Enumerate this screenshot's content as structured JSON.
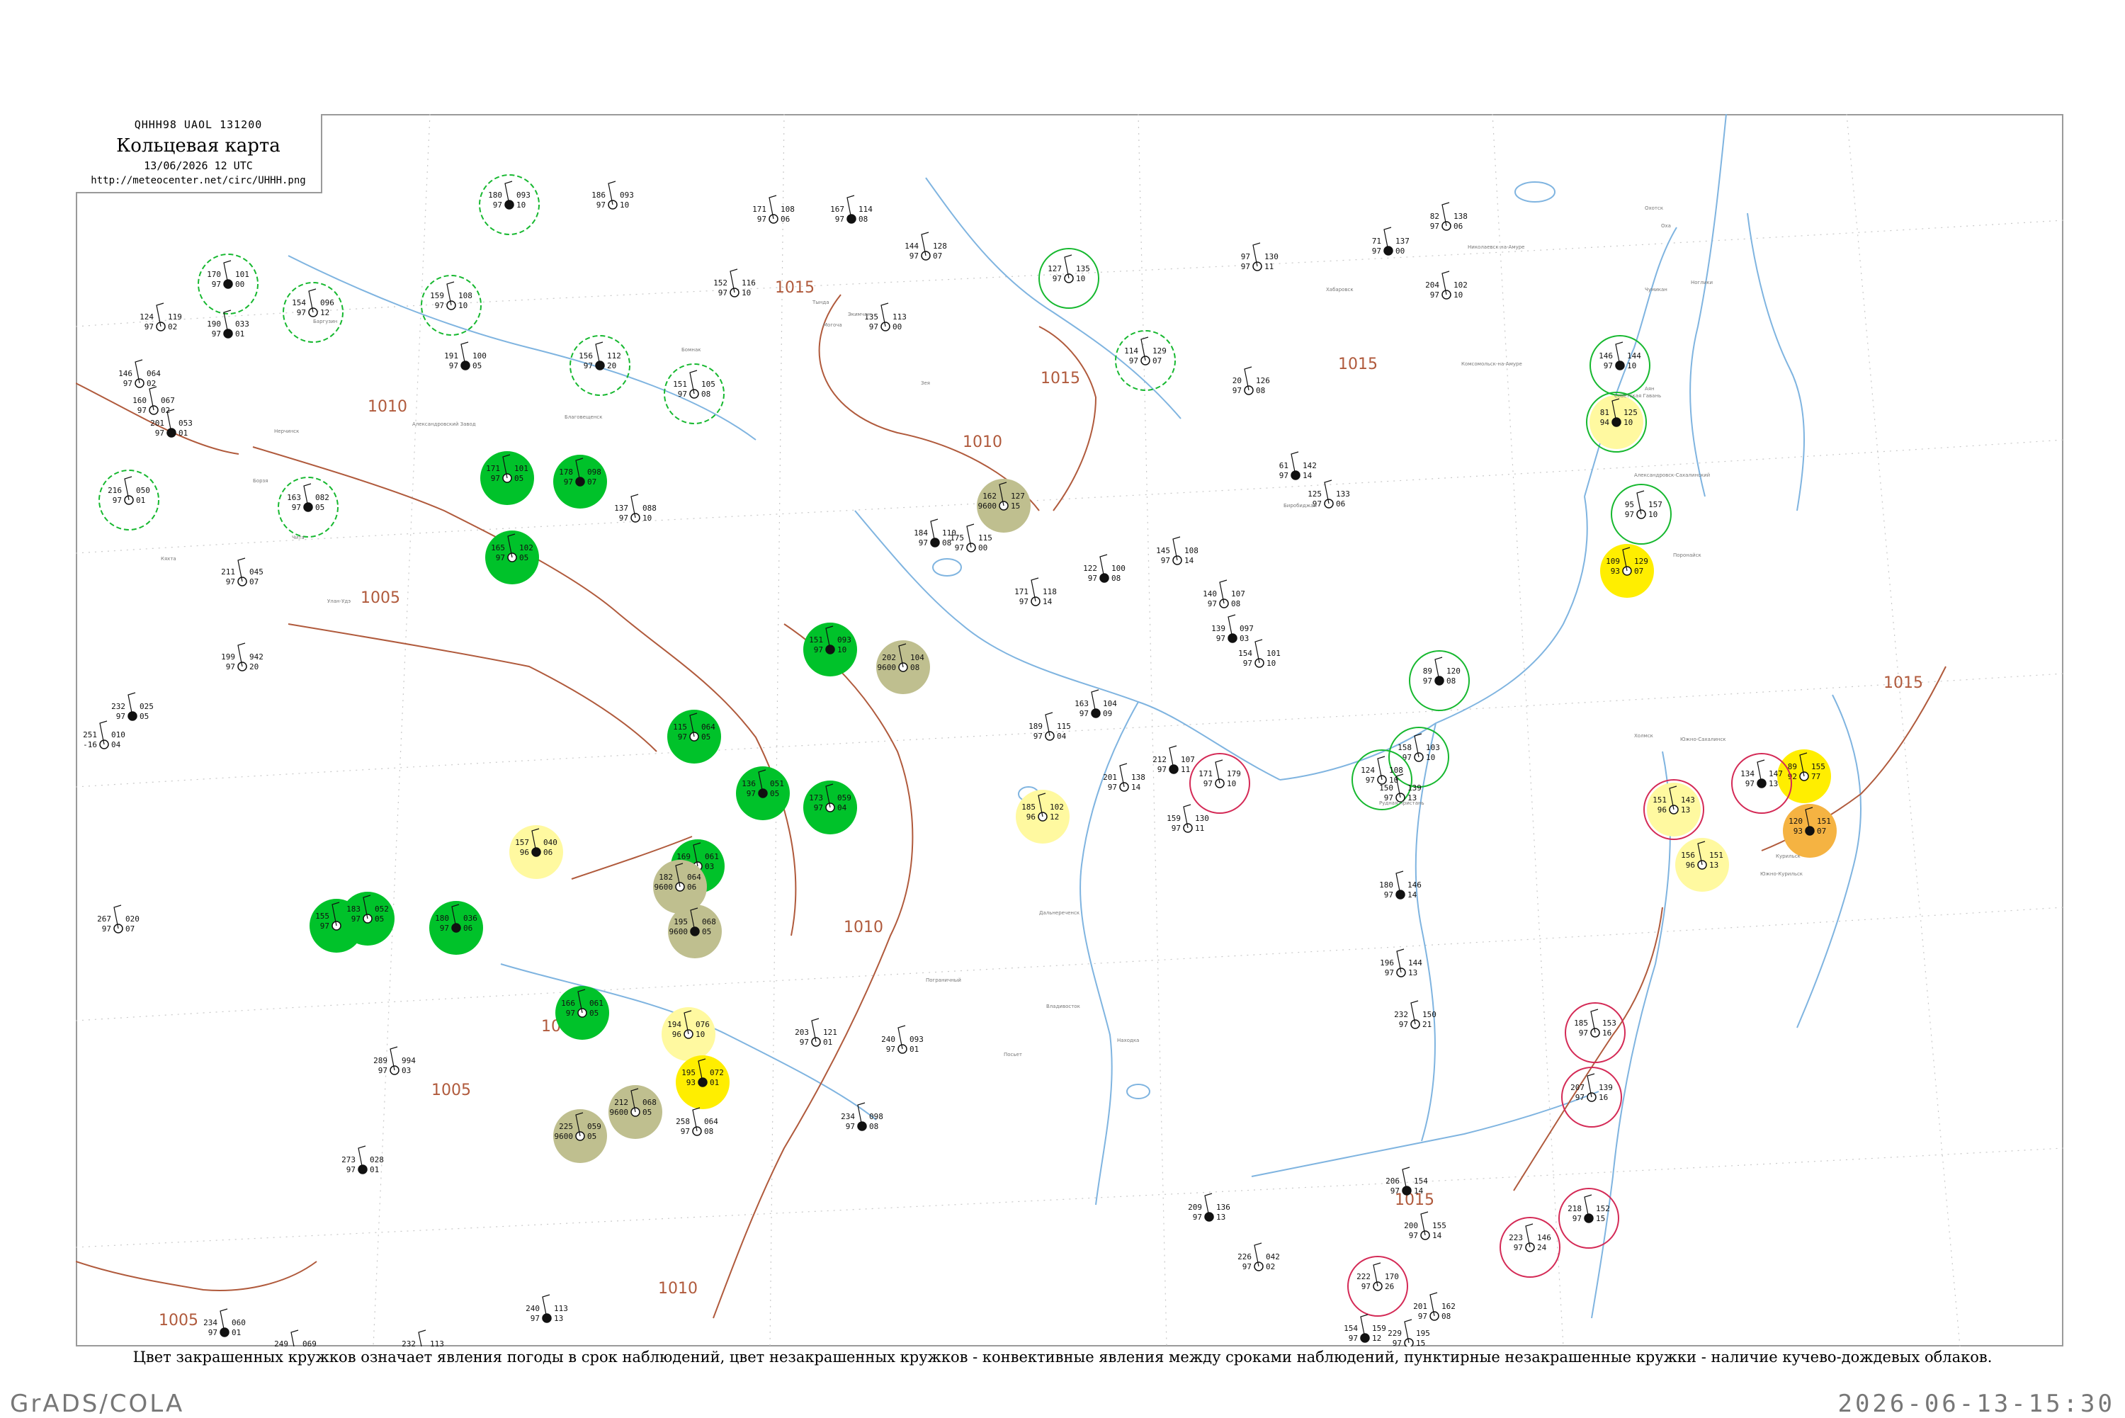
{
  "header": {
    "code": "QHHH98  UAOL  131200",
    "title": "Кольцевая карта",
    "date": "13/06/2026 12 UTC",
    "url": "http://meteocenter.net/circ/UHHH.png"
  },
  "caption": "Цвет закрашенных кружков означает явления погоды в срок наблюдений, цвет незакрашенных кружков - конвективные явления между сроками наблюдений, пунктирные незакрашенные кружки - наличие кучево-дождевых облаков.",
  "footer": {
    "left": "GrADS/COLA",
    "right": "2026-06-13-15:30"
  },
  "colors": {
    "isobar": "#b05a3c",
    "water": "#7fb4e0",
    "rain_fill": "#00c22a",
    "fog_fill": "#bfbf8f",
    "haze_fill": "#fff9a0",
    "yellow_fill": "#ffee00",
    "orange_fill": "#f5b342",
    "ring_green": "#16b82f",
    "ring_red": "#d42a56",
    "frame": "#9a9a9a"
  },
  "isobars": [
    {
      "label": "1015"
    },
    {
      "label": "1015"
    },
    {
      "label": "1015"
    },
    {
      "label": "1015"
    },
    {
      "label": "1015"
    },
    {
      "label": "1010"
    },
    {
      "label": "1010"
    },
    {
      "label": "1010"
    },
    {
      "label": "1010"
    },
    {
      "label": "1005"
    },
    {
      "label": "1005"
    },
    {
      "label": "1005"
    },
    {
      "label": "1005"
    }
  ],
  "stations": [
    {
      "t": "180",
      "d": "97",
      "p": "093",
      "v": "10",
      "fill": "",
      "ring": "green-dash"
    },
    {
      "t": "186",
      "d": "97",
      "p": "093",
      "v": "10",
      "fill": "",
      "ring": ""
    },
    {
      "t": "171",
      "d": "97",
      "p": "108",
      "v": "06",
      "fill": "",
      "ring": ""
    },
    {
      "t": "167",
      "d": "97",
      "p": "114",
      "v": "08",
      "fill": "",
      "ring": ""
    },
    {
      "t": "144",
      "d": "97",
      "p": "128",
      "v": "07",
      "fill": "",
      "ring": ""
    },
    {
      "t": "127",
      "d": "97",
      "p": "135",
      "v": "10",
      "fill": "",
      "ring": "green"
    },
    {
      "t": "170",
      "d": "97",
      "p": "101",
      "v": "00",
      "fill": "",
      "ring": "green-dash"
    },
    {
      "t": "154",
      "d": "97",
      "p": "096",
      "v": "12",
      "fill": "",
      "ring": "green-dash"
    },
    {
      "t": "159",
      "d": "97",
      "p": "108",
      "v": "10",
      "fill": "",
      "ring": "green-dash"
    },
    {
      "t": "156",
      "d": "97",
      "p": "112",
      "v": "20",
      "fill": "",
      "ring": "green-dash"
    },
    {
      "t": "151",
      "d": "97",
      "p": "105",
      "v": "08",
      "fill": "",
      "ring": "green-dash"
    },
    {
      "t": "114",
      "d": "97",
      "p": "129",
      "v": "07",
      "fill": "",
      "ring": "green-dash"
    },
    {
      "t": "163",
      "d": "97",
      "p": "082",
      "v": "05",
      "fill": "",
      "ring": "green-dash"
    },
    {
      "t": "216",
      "d": "97",
      "p": "050",
      "v": "01",
      "fill": "",
      "ring": "green-dash"
    },
    {
      "t": "171",
      "d": "97",
      "p": "101",
      "v": "05",
      "fill": "rain",
      "ring": ""
    },
    {
      "t": "178",
      "d": "97",
      "p": "098",
      "v": "07",
      "fill": "rain",
      "ring": ""
    },
    {
      "t": "165",
      "d": "97",
      "p": "102",
      "v": "05",
      "fill": "rain",
      "ring": ""
    },
    {
      "t": "162",
      "d": "9600",
      "p": "127",
      "v": "15",
      "fill": "fog",
      "ring": ""
    },
    {
      "t": "151",
      "d": "97",
      "p": "093",
      "v": "10",
      "fill": "rain",
      "ring": ""
    },
    {
      "t": "202",
      "d": "9600",
      "p": "104",
      "v": "08",
      "fill": "fog",
      "ring": ""
    },
    {
      "t": "115",
      "d": "97",
      "p": "064",
      "v": "05",
      "fill": "rain",
      "ring": ""
    },
    {
      "t": "136",
      "d": "97",
      "p": "051",
      "v": "05",
      "fill": "rain",
      "ring": ""
    },
    {
      "t": "173",
      "d": "97",
      "p": "059",
      "v": "04",
      "fill": "rain",
      "ring": ""
    },
    {
      "t": "185",
      "d": "96",
      "p": "102",
      "v": "12",
      "fill": "haze",
      "ring": ""
    },
    {
      "t": "157",
      "d": "96",
      "p": "040",
      "v": "06",
      "fill": "haze",
      "ring": ""
    },
    {
      "t": "169",
      "d": "97",
      "p": "061",
      "v": "03",
      "fill": "rain",
      "ring": ""
    },
    {
      "t": "182",
      "d": "9600",
      "p": "064",
      "v": "06",
      "fill": "fog",
      "ring": ""
    },
    {
      "t": "195",
      "d": "9600",
      "p": "068",
      "v": "05",
      "fill": "fog",
      "ring": ""
    },
    {
      "t": "155",
      "d": "97",
      "p": "067",
      "v": "05",
      "fill": "rain",
      "ring": ""
    },
    {
      "t": "183",
      "d": "97",
      "p": "052",
      "v": "05",
      "fill": "rain",
      "ring": ""
    },
    {
      "t": "180",
      "d": "97",
      "p": "036",
      "v": "06",
      "fill": "rain",
      "ring": ""
    },
    {
      "t": "194",
      "d": "96",
      "p": "076",
      "v": "10",
      "fill": "haze",
      "ring": ""
    },
    {
      "t": "166",
      "d": "97",
      "p": "061",
      "v": "05",
      "fill": "rain",
      "ring": ""
    },
    {
      "t": "195",
      "d": "93",
      "p": "072",
      "v": "01",
      "fill": "yellow",
      "ring": ""
    },
    {
      "t": "212",
      "d": "9600",
      "p": "068",
      "v": "05",
      "fill": "fog",
      "ring": ""
    },
    {
      "t": "225",
      "d": "9600",
      "p": "059",
      "v": "05",
      "fill": "fog",
      "ring": ""
    },
    {
      "t": "81",
      "d": "94",
      "p": "125",
      "v": "10",
      "fill": "haze",
      "ring": "green"
    },
    {
      "t": "109",
      "d": "93",
      "p": "129",
      "v": "07",
      "fill": "yellow",
      "ring": ""
    },
    {
      "t": "89",
      "d": "92",
      "p": "155",
      "v": "77",
      "fill": "yellow",
      "ring": ""
    },
    {
      "t": "120",
      "d": "93",
      "p": "151",
      "v": "07",
      "fill": "orange",
      "ring": ""
    },
    {
      "t": "151",
      "d": "96",
      "p": "143",
      "v": "13",
      "fill": "haze",
      "ring": "red"
    },
    {
      "t": "156",
      "d": "96",
      "p": "151",
      "v": "13",
      "fill": "haze",
      "ring": ""
    },
    {
      "t": "89",
      "d": "97",
      "p": "120",
      "v": "08",
      "fill": "",
      "ring": "green"
    },
    {
      "t": "158",
      "d": "97",
      "p": "103",
      "v": "10",
      "fill": "",
      "ring": "green"
    },
    {
      "t": "124",
      "d": "97",
      "p": "108",
      "v": "10",
      "fill": "",
      "ring": "green"
    },
    {
      "t": "146",
      "d": "97",
      "p": "144",
      "v": "10",
      "fill": "",
      "ring": "green"
    },
    {
      "t": "95",
      "d": "97",
      "p": "157",
      "v": "10",
      "fill": "",
      "ring": "green"
    },
    {
      "t": "171",
      "d": "97",
      "p": "179",
      "v": "10",
      "fill": "",
      "ring": "red"
    },
    {
      "t": "134",
      "d": "97",
      "p": "147",
      "v": "13",
      "fill": "",
      "ring": "red"
    },
    {
      "t": "185",
      "d": "97",
      "p": "153",
      "v": "16",
      "fill": "",
      "ring": "red"
    },
    {
      "t": "207",
      "d": "97",
      "p": "139",
      "v": "16",
      "fill": "",
      "ring": "red"
    },
    {
      "t": "218",
      "d": "97",
      "p": "152",
      "v": "15",
      "fill": "",
      "ring": "red"
    },
    {
      "t": "223",
      "d": "97",
      "p": "146",
      "v": "24",
      "fill": "",
      "ring": "red"
    },
    {
      "t": "222",
      "d": "97",
      "p": "170",
      "v": "26",
      "fill": "",
      "ring": "red"
    },
    {
      "t": "209",
      "d": "97",
      "p": "136",
      "v": "13",
      "fill": "",
      "ring": ""
    },
    {
      "t": "203",
      "d": "97",
      "p": "121",
      "v": "01",
      "fill": "",
      "ring": ""
    },
    {
      "t": "240",
      "d": "97",
      "p": "093",
      "v": "01",
      "fill": "",
      "ring": ""
    },
    {
      "t": "234",
      "d": "97",
      "p": "098",
      "v": "08",
      "fill": "",
      "ring": ""
    },
    {
      "t": "258",
      "d": "97",
      "p": "064",
      "v": "08",
      "fill": "",
      "ring": ""
    },
    {
      "t": "289",
      "d": "97",
      "p": "994",
      "v": "03",
      "fill": "",
      "ring": ""
    },
    {
      "t": "273",
      "d": "97",
      "p": "028",
      "v": "01",
      "fill": "",
      "ring": ""
    },
    {
      "t": "267",
      "d": "97",
      "p": "020",
      "v": "07",
      "fill": "",
      "ring": ""
    },
    {
      "t": "251",
      "d": "-16",
      "p": "010",
      "v": "04",
      "fill": "",
      "ring": ""
    },
    {
      "t": "232",
      "d": "97",
      "p": "025",
      "v": "05",
      "fill": "",
      "ring": ""
    },
    {
      "t": "199",
      "d": "97",
      "p": "942",
      "v": "20",
      "fill": "",
      "ring": ""
    },
    {
      "t": "211",
      "d": "97",
      "p": "045",
      "v": "07",
      "fill": "",
      "ring": ""
    },
    {
      "t": "190",
      "d": "97",
      "p": "033",
      "v": "01",
      "fill": "",
      "ring": ""
    },
    {
      "t": "146",
      "d": "97",
      "p": "064",
      "v": "02",
      "fill": "",
      "ring": ""
    },
    {
      "t": "160",
      "d": "97",
      "p": "067",
      "v": "02",
      "fill": "",
      "ring": ""
    },
    {
      "t": "201",
      "d": "97",
      "p": "053",
      "v": "01",
      "fill": "",
      "ring": ""
    },
    {
      "t": "137",
      "d": "97",
      "p": "088",
      "v": "10",
      "fill": "",
      "ring": ""
    },
    {
      "t": "124",
      "d": "97",
      "p": "119",
      "v": "02",
      "fill": "",
      "ring": ""
    },
    {
      "t": "191",
      "d": "97",
      "p": "100",
      "v": "05",
      "fill": "",
      "ring": ""
    },
    {
      "t": "152",
      "d": "97",
      "p": "116",
      "v": "10",
      "fill": "",
      "ring": ""
    },
    {
      "t": "135",
      "d": "97",
      "p": "113",
      "v": "00",
      "fill": "",
      "ring": ""
    },
    {
      "t": "184",
      "d": "97",
      "p": "110",
      "v": "08",
      "fill": "",
      "ring": ""
    },
    {
      "t": "175",
      "d": "97",
      "p": "115",
      "v": "00",
      "fill": "",
      "ring": ""
    },
    {
      "t": "171",
      "d": "97",
      "p": "118",
      "v": "14",
      "fill": "",
      "ring": ""
    },
    {
      "t": "122",
      "d": "97",
      "p": "100",
      "v": "08",
      "fill": "",
      "ring": ""
    },
    {
      "t": "145",
      "d": "97",
      "p": "108",
      "v": "14",
      "fill": "",
      "ring": ""
    },
    {
      "t": "140",
      "d": "97",
      "p": "107",
      "v": "08",
      "fill": "",
      "ring": ""
    },
    {
      "t": "139",
      "d": "97",
      "p": "097",
      "v": "03",
      "fill": "",
      "ring": ""
    },
    {
      "t": "154",
      "d": "97",
      "p": "101",
      "v": "10",
      "fill": "",
      "ring": ""
    },
    {
      "t": "125",
      "d": "97",
      "p": "133",
      "v": "06",
      "fill": "",
      "ring": ""
    },
    {
      "t": "61",
      "d": "97",
      "p": "142",
      "v": "14",
      "fill": "",
      "ring": ""
    },
    {
      "t": "97",
      "d": "97",
      "p": "130",
      "v": "11",
      "fill": "",
      "ring": ""
    },
    {
      "t": "20",
      "d": "97",
      "p": "126",
      "v": "08",
      "fill": "",
      "ring": ""
    },
    {
      "t": "71",
      "d": "97",
      "p": "137",
      "v": "00",
      "fill": "",
      "ring": ""
    },
    {
      "t": "82",
      "d": "97",
      "p": "138",
      "v": "06",
      "fill": "",
      "ring": ""
    },
    {
      "t": "204",
      "d": "97",
      "p": "102",
      "v": "10",
      "fill": "",
      "ring": ""
    },
    {
      "t": "163",
      "d": "97",
      "p": "104",
      "v": "09",
      "fill": "",
      "ring": ""
    },
    {
      "t": "189",
      "d": "97",
      "p": "115",
      "v": "04",
      "fill": "",
      "ring": ""
    },
    {
      "t": "201",
      "d": "97",
      "p": "138",
      "v": "14",
      "fill": "",
      "ring": ""
    },
    {
      "t": "212",
      "d": "97",
      "p": "107",
      "v": "11",
      "fill": "",
      "ring": ""
    },
    {
      "t": "159",
      "d": "97",
      "p": "130",
      "v": "11",
      "fill": "",
      "ring": ""
    },
    {
      "t": "150",
      "d": "97",
      "p": "139",
      "v": "13",
      "fill": "",
      "ring": ""
    },
    {
      "t": "180",
      "d": "97",
      "p": "146",
      "v": "14",
      "fill": "",
      "ring": ""
    },
    {
      "t": "196",
      "d": "97",
      "p": "144",
      "v": "13",
      "fill": "",
      "ring": ""
    },
    {
      "t": "232",
      "d": "97",
      "p": "150",
      "v": "21",
      "fill": "",
      "ring": ""
    },
    {
      "t": "206",
      "d": "97",
      "p": "154",
      "v": "14",
      "fill": "",
      "ring": ""
    },
    {
      "t": "200",
      "d": "97",
      "p": "155",
      "v": "14",
      "fill": "",
      "ring": ""
    },
    {
      "t": "201",
      "d": "97",
      "p": "162",
      "v": "08",
      "fill": "",
      "ring": ""
    },
    {
      "t": "154",
      "d": "97",
      "p": "159",
      "v": "12",
      "fill": "",
      "ring": ""
    },
    {
      "t": "229",
      "d": "97",
      "p": "195",
      "v": "15",
      "fill": "",
      "ring": ""
    },
    {
      "t": "226",
      "d": "97",
      "p": "042",
      "v": "02",
      "fill": "",
      "ring": ""
    },
    {
      "t": "234",
      "d": "97",
      "p": "060",
      "v": "01",
      "fill": "",
      "ring": ""
    },
    {
      "t": "249",
      "d": "97",
      "p": "069",
      "v": "06",
      "fill": "",
      "ring": ""
    },
    {
      "t": "232",
      "d": "97",
      "p": "113",
      "v": "14",
      "fill": "",
      "ring": ""
    },
    {
      "t": "240",
      "d": "97",
      "p": "113",
      "v": "13",
      "fill": "",
      "ring": ""
    }
  ],
  "station_names": [
    "Хабаровск",
    "Николаевск-на-Амуре",
    "Комсомольск-на-Амуре",
    "Советская Гавань",
    "Благовещенск",
    "Тында",
    "Зея",
    "Биробиджан",
    "Чита",
    "Могоча",
    "Нерчинск",
    "Александровский Завод",
    "Борзя",
    "Кяхта",
    "Улан-Удэ",
    "Баргузин",
    "Бомнак",
    "Экимчан",
    "Охотск",
    "Аян",
    "Чумикан",
    "Поронайск",
    "Южно-Сахалинск",
    "Холмск",
    "Владивосток",
    "Находка",
    "Посьет",
    "Пограничный",
    "Дальнереченск",
    "Рудная Пристань",
    "Оха",
    "Ноглики",
    "Александровск-Сахалинский",
    "Курильск",
    "Южно-Курильск"
  ]
}
